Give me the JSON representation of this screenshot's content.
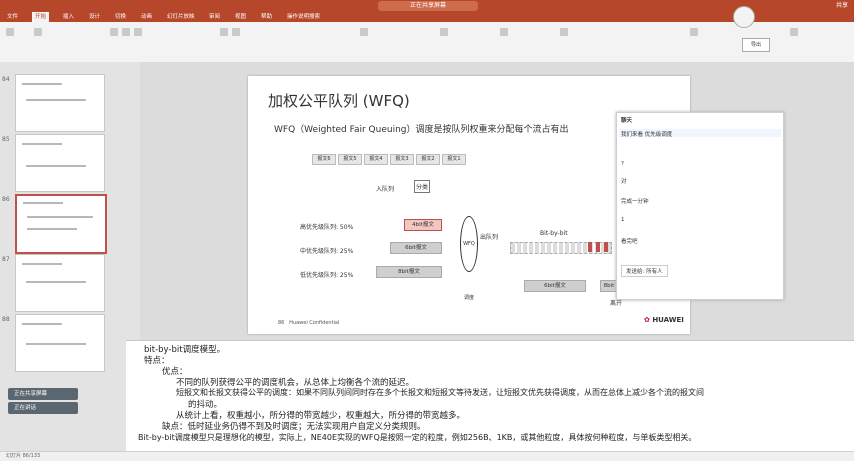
{
  "window": {
    "title": "正在共享屏幕",
    "share": "共享"
  },
  "tabs": [
    "文件",
    "开始",
    "插入",
    "设计",
    "切换",
    "动画",
    "幻灯片放映",
    "审阅",
    "视图",
    "帮助",
    "操作说明搜索"
  ],
  "active_tab": "开始",
  "ribbon": {
    "present_button": "导出"
  },
  "slides": [
    {
      "num": "84"
    },
    {
      "num": "85"
    },
    {
      "num": "86"
    },
    {
      "num": "87"
    },
    {
      "num": "88"
    }
  ],
  "slide": {
    "title": "加权公平队列 (WFQ)",
    "bullet": "WFQ（Weighted Fair Queuing）调度是按队列权重来分配每个流占有出",
    "packets": [
      "报文6",
      "报文5",
      "报文4",
      "报文3",
      "报文2",
      "报文1"
    ],
    "enqueue": "入队列",
    "classify": "分类",
    "q_high": "高优先级队列: 50%",
    "q_mid": "中优先级队列: 25%",
    "q_low": "低优先级队列: 25%",
    "pkt_high": "4bit报文",
    "pkt_mid": "6bit报文",
    "pkt_low": "8bit报文",
    "wfq": "WFQ调度",
    "dequeue": "出队列",
    "bitbybit": "Bit-by-bit",
    "out_pkt1": "6bit报文",
    "out_pkt2": "8bit",
    "out_label": "离开",
    "footer": "Huawei Confidential",
    "page": "86",
    "brand": "HUAWEI"
  },
  "panel": {
    "title": "聊天",
    "lines": [
      "我们来看 优先级调度",
      "?",
      "对",
      "完成一分钟",
      "1",
      "看完吧",
      "发送给: 所有人"
    ]
  },
  "notes": [
    "bit-by-bit调度模型。",
    "特点：",
    "优点：",
    "不同的队列获得公平的调度机会，从总体上均衡各个流的延迟。",
    "短报文和长报文获得公平的调度：如果不同队列间同时存在多个长报文和短报文等待发送，让短报文优先获得调度，从而在总体上减少各个流的报文间",
    "的抖动。",
    "从统计上看，权重越小，所分得的带宽越少，权重越大，所分得的带宽越多。",
    "缺点：低时延业务仍得不到及时调度；无法实现用户自定义分类规则。",
    "Bit-by-bit调度模型只是理想化的模型，实际上，NE40E实现的WFQ是按照一定的粒度，例如256B、1KB，或其他粒度，具体按何种粒度，与单板类型相关。"
  ],
  "toasts": [
    "正在共享屏幕",
    "正在讲话"
  ],
  "status": "幻灯片 86/133"
}
